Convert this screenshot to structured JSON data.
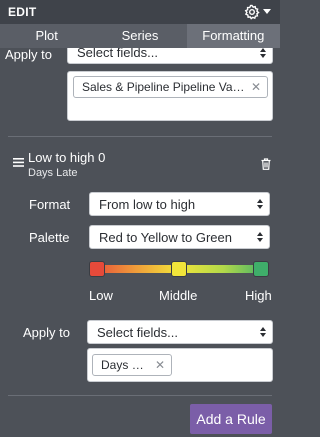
{
  "header": {
    "title": "EDIT"
  },
  "tabs": [
    {
      "label": "Plot",
      "active": false
    },
    {
      "label": "Series",
      "active": false
    },
    {
      "label": "Formatting",
      "active": true
    }
  ],
  "rule1": {
    "apply_to_label": "Apply to",
    "select_value": "Select fields...",
    "tags": [
      "Sales & Pipeline Pipeline Value ..."
    ]
  },
  "rule2": {
    "title": "Low to high 0",
    "subtitle": "Days Late",
    "format_label": "Format",
    "format_value": "From low to high",
    "palette_label": "Palette",
    "palette_value": "Red to Yellow to Green",
    "scale": {
      "low": "Low",
      "middle": "Middle",
      "high": "High"
    },
    "handle_colors": {
      "low": "#e64a3a",
      "middle": "#f2e53a",
      "high": "#3fae6a"
    },
    "apply_to_label": "Apply to",
    "select_value": "Select fields...",
    "tags": [
      "Days Late"
    ]
  },
  "footer": {
    "add_rule_label": "Add a Rule"
  },
  "colors": {
    "panel_bg": "#4d5158",
    "header_bg": "#3f434a",
    "tab_bg": "#5a5e66",
    "tab_active_bg": "#6c7079",
    "accent": "#7b5ea8"
  }
}
